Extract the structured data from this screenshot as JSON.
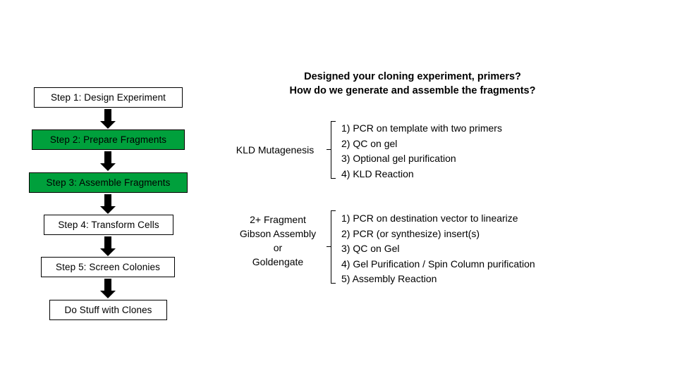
{
  "page": {
    "background_color": "#ffffff",
    "accent_green": "#00A03C",
    "line_color": "#000000"
  },
  "flowchart": {
    "name": "cloning-workflow-steps",
    "steps": [
      {
        "label": "Step 1: Design Experiment",
        "highlighted": false
      },
      {
        "label": "Step 2: Prepare Fragments",
        "highlighted": true
      },
      {
        "label": "Step 3: Assemble Fragments",
        "highlighted": true
      },
      {
        "label": "Step 4: Transform Cells",
        "highlighted": false
      },
      {
        "label": "Step 5: Screen Colonies",
        "highlighted": false
      },
      {
        "label": "Do Stuff with Clones",
        "highlighted": false
      }
    ]
  },
  "headline": {
    "line1": "Designed your cloning experiment, primers?",
    "line2": "How do we generate and assemble the fragments?"
  },
  "methods": [
    {
      "name": "kld-mutagenesis",
      "label_lines": [
        "KLD Mutagenesis"
      ],
      "steps": [
        "1) PCR on template with two primers",
        "2) QC on gel",
        "3) Optional gel purification",
        "4) KLD Reaction"
      ]
    },
    {
      "name": "gibson-goldengate",
      "label_lines": [
        "2+ Fragment",
        "Gibson Assembly",
        "or",
        "Goldengate"
      ],
      "steps": [
        "1) PCR on destination vector to linearize",
        "2) PCR (or synthesize) insert(s)",
        "3) QC on Gel",
        "4) Gel Purification / Spin Column purification",
        "5) Assembly Reaction"
      ]
    }
  ]
}
